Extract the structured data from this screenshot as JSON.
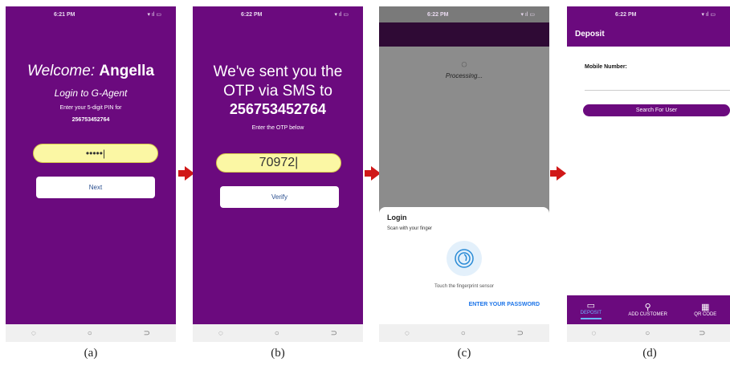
{
  "panels": {
    "a": {
      "time": "6:21 PM",
      "welcome_prefix": "Welcome:",
      "welcome_name": "Angella",
      "login_title": "Login to G-Agent",
      "pin_prompt": "Enter your 5-digit PIN for",
      "phone_number": "256753452764",
      "pin_masked": "•••••",
      "next_label": "Next",
      "caption": "(a)"
    },
    "b": {
      "time": "6:22 PM",
      "otp_line1": "We've sent you the",
      "otp_line2": "OTP via SMS to",
      "phone_number": "256753452764",
      "otp_prompt": "Enter the OTP below",
      "otp_value": "70972",
      "verify_label": "Verify",
      "caption": "(b)"
    },
    "c": {
      "time": "6:22 PM",
      "processing": "Processing...",
      "sheet_title": "Login",
      "sheet_subtitle": "Scan with your finger",
      "touch_hint": "Touch the fingerprint sensor",
      "enter_password": "ENTER YOUR PASSWORD",
      "caption": "(c)"
    },
    "d": {
      "time": "6:22 PM",
      "title": "Deposit",
      "mobile_label": "Mobile Number:",
      "search_label": "Search For User",
      "tabs": [
        "DEPOSIT",
        "ADD CUSTOMER",
        "QR CODE"
      ],
      "caption": "(d)"
    }
  },
  "nav_icons": [
    "recent-apps-icon",
    "home-icon",
    "back-icon"
  ],
  "colors": {
    "purple": "#6b0a7e",
    "field_yellow": "#fbf7a4",
    "arrow_red": "#d01818",
    "link_blue": "#1a73e8"
  }
}
